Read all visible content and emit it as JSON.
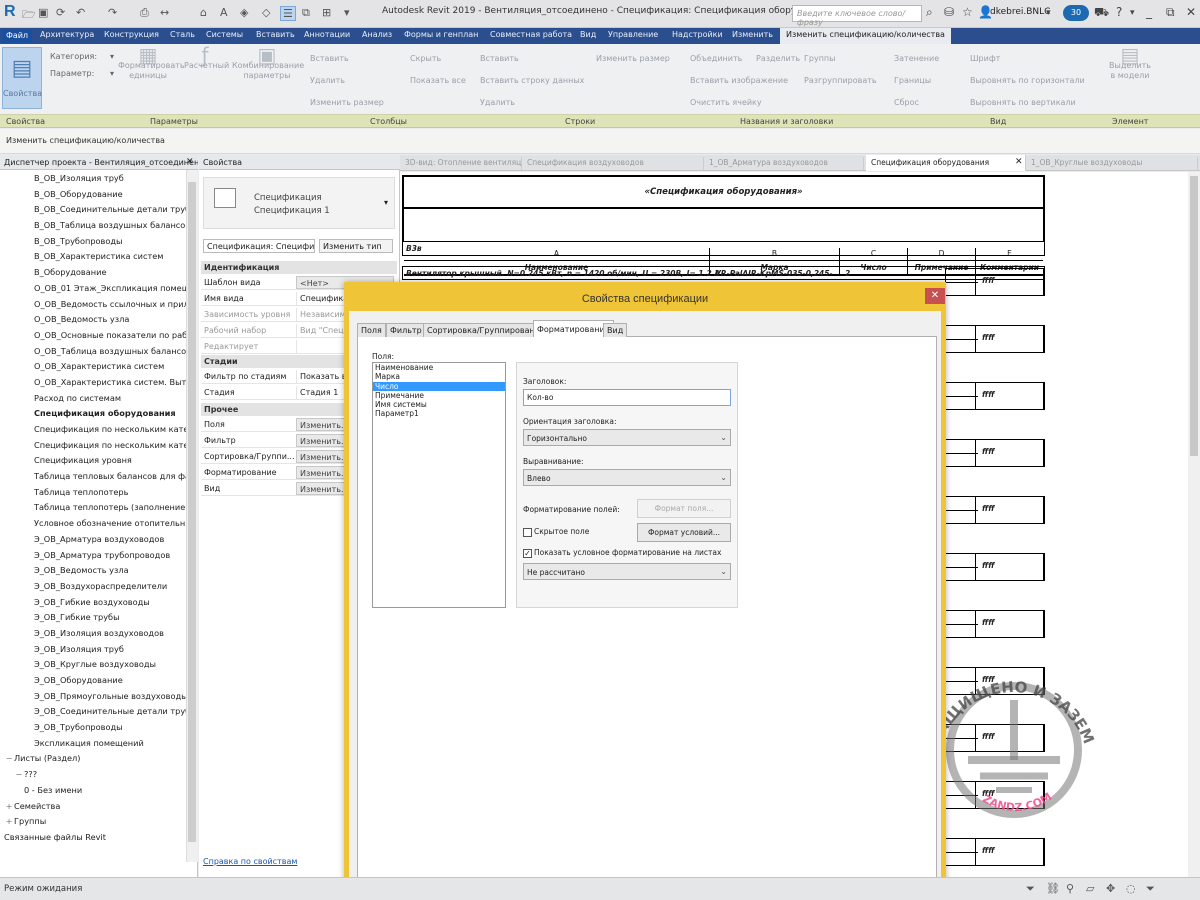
{
  "app": {
    "logo": "R",
    "window_title": "Autodesk Revit 2019 - Вентиляция_отсоединено - Спецификация: Спецификация оборудования",
    "search_placeholder": "Введите ключевое слово/фразу",
    "user": "dkebrei.BNLC",
    "notifications": "30"
  },
  "ribbon": {
    "file_tab": "Файл",
    "tabs": [
      "Архитектура",
      "Конструкция",
      "Сталь",
      "Системы",
      "Вставить",
      "Аннотации",
      "Анализ",
      "Формы и генплан",
      "Совместная работа",
      "Вид",
      "Управление",
      "Надстройки",
      "Изменить"
    ],
    "active_tab": "Изменить спецификацию/количества",
    "groups": [
      "Свойства",
      "Параметры",
      "Столбцы",
      "Строки",
      "Названия и заголовки",
      "Вид",
      "Элемент"
    ],
    "properties_button": "Свойства",
    "category_label": "Категория:",
    "parameter_label": "Параметр:",
    "param_buttons": [
      "Форматировать единицы",
      "Расчетный",
      "Комбинирование параметры"
    ],
    "column_buttons": [
      "Вставить",
      "Удалить",
      "Изменить размер",
      "Скрыть",
      "Показать все",
      "Вставить",
      "Вставить строку данных",
      "Удалить"
    ],
    "row_buttons": [
      "Изменить размер"
    ],
    "title_buttons": [
      "Объединить",
      "Разделить",
      "Вставить изображение",
      "Очистить ячейку",
      "Группы",
      "Разгруппировать"
    ],
    "view_buttons": [
      "Затенение",
      "Границы",
      "Сброс",
      "Шрифт",
      "Выровнять по горизонтали",
      "Выровнять по вертикали"
    ],
    "element_button": "Выделить в модели",
    "context_label": "Изменить спецификацию/количества"
  },
  "browser": {
    "title": "Диспетчер проекта - Вентиляция_отсоединено",
    "items": [
      {
        "label": "В_ОВ_Изоляция труб",
        "indent": 3
      },
      {
        "label": "В_ОВ_Оборудование",
        "indent": 3
      },
      {
        "label": "В_ОВ_Соединительные детали трубопр",
        "indent": 3
      },
      {
        "label": "В_ОВ_Таблица воздушных балансов",
        "indent": 3
      },
      {
        "label": "В_ОВ_Трубопроводы",
        "indent": 3
      },
      {
        "label": "В_ОВ_Характеристика систем",
        "indent": 3
      },
      {
        "label": "В_Оборудование",
        "indent": 3
      },
      {
        "label": "О_ОВ_01 Этаж_Экспликация помещен",
        "indent": 3
      },
      {
        "label": "О_ОВ_Ведомость ссылочных и прилаг",
        "indent": 3
      },
      {
        "label": "О_ОВ_Ведомость узла",
        "indent": 3
      },
      {
        "label": "О_ОВ_Основные показатели по рабоч",
        "indent": 3
      },
      {
        "label": "О_ОВ_Таблица воздушных балансов",
        "indent": 3
      },
      {
        "label": "О_ОВ_Характеристика систем",
        "indent": 3
      },
      {
        "label": "О_ОВ_Характеристика систем. Вытяжн",
        "indent": 3
      },
      {
        "label": "Расход по системам",
        "indent": 3
      },
      {
        "label": "Спецификация оборудования",
        "indent": 3,
        "selected": true
      },
      {
        "label": "Спецификация по нескольким категор",
        "indent": 3
      },
      {
        "label": "Спецификация по нескольким категор",
        "indent": 3
      },
      {
        "label": "Спецификация уровня",
        "indent": 3
      },
      {
        "label": "Таблица тепловых балансов для фанко",
        "indent": 3
      },
      {
        "label": "Таблица теплопотерь",
        "indent": 3
      },
      {
        "label": "Таблица теплопотерь (заполнение)",
        "indent": 3
      },
      {
        "label": "Условное обозначение отопительных с",
        "indent": 3
      },
      {
        "label": "Э_ОВ_Арматура воздуховодов",
        "indent": 3
      },
      {
        "label": "Э_ОВ_Арматура трубопроводов",
        "indent": 3
      },
      {
        "label": "Э_ОВ_Ведомость узла",
        "indent": 3
      },
      {
        "label": "Э_ОВ_Воздухораспределители",
        "indent": 3
      },
      {
        "label": "Э_ОВ_Гибкие воздуховоды",
        "indent": 3
      },
      {
        "label": "Э_ОВ_Гибкие трубы",
        "indent": 3
      },
      {
        "label": "Э_ОВ_Изоляция воздуховодов",
        "indent": 3
      },
      {
        "label": "Э_ОВ_Изоляция труб",
        "indent": 3
      },
      {
        "label": "Э_ОВ_Круглые воздуховоды",
        "indent": 3
      },
      {
        "label": "Э_ОВ_Оборудование",
        "indent": 3
      },
      {
        "label": "Э_ОВ_Прямоугольные воздуховоды",
        "indent": 3
      },
      {
        "label": "Э_ОВ_Соединительные детали трубопр",
        "indent": 3
      },
      {
        "label": "Э_ОВ_Трубопроводы",
        "indent": 3
      },
      {
        "label": "Экспликация помещений",
        "indent": 3
      },
      {
        "label": "Листы (Раздел)",
        "indent": 0,
        "toggle": "−"
      },
      {
        "label": "???",
        "indent": 1,
        "toggle": "−"
      },
      {
        "label": "0 - Без имени",
        "indent": 2
      },
      {
        "label": "Семейства",
        "indent": 0,
        "toggle": "+"
      },
      {
        "label": "Группы",
        "indent": 0,
        "toggle": "+"
      },
      {
        "label": "Связанные файлы Revit",
        "indent": 0
      }
    ]
  },
  "properties": {
    "title": "Свойства",
    "type_line1": "Спецификация",
    "type_line2": "Спецификация 1",
    "selector": "Спецификация: Специфи",
    "edit_type": "Изменить тип",
    "sections": {
      "identity": "Идентификация",
      "stages": "Стадии",
      "other": "Прочее"
    },
    "rows_identity": [
      {
        "k": "Шаблон вида",
        "v": "<Нет>",
        "grey": false,
        "btn": true
      },
      {
        "k": "Имя вида",
        "v": "Спецификация",
        "grey": false
      },
      {
        "k": "Зависимость уровня",
        "v": "Независимый",
        "grey": true
      },
      {
        "k": "Рабочий набор",
        "v": "Вид \"Специф",
        "grey": true
      },
      {
        "k": "Редактирует",
        "v": "",
        "grey": true
      }
    ],
    "rows_stages": [
      {
        "k": "Фильтр по стадиям",
        "v": "Показать все"
      },
      {
        "k": "Стадия",
        "v": "Стадия 1"
      }
    ],
    "rows_other": [
      {
        "k": "Поля",
        "v": "Изменить..."
      },
      {
        "k": "Фильтр",
        "v": "Изменить..."
      },
      {
        "k": "Сортировка/Группи...",
        "v": "Изменить..."
      },
      {
        "k": "Форматирование",
        "v": "Изменить..."
      },
      {
        "k": "Вид",
        "v": "Изменить..."
      }
    ],
    "help_link": "Справка по свойствам"
  },
  "view_tabs": [
    {
      "label": "3D-вид: Отопление вентиляция",
      "active": false
    },
    {
      "label": "Спецификация воздуховодов",
      "active": false
    },
    {
      "label": "1_ОВ_Арматура воздуховодов",
      "active": false
    },
    {
      "label": "Спецификация оборудования",
      "active": true
    },
    {
      "label": "1_ОВ_Круглые воздуховоды",
      "active": false
    }
  ],
  "schedule": {
    "title": "«Спецификация оборудования»",
    "columns": [
      {
        "letter": "A",
        "header": "Наименование"
      },
      {
        "letter": "B",
        "header": "Марка"
      },
      {
        "letter": "C",
        "header": "Число"
      },
      {
        "letter": "D",
        "header": "Примечание"
      },
      {
        "letter": "E",
        "header": "Комментарии"
      }
    ],
    "group": "В3в",
    "row": {
      "name": "Вентилятор крышный. N=0.245 кВт, n = 1420 об/мин, U = 230В, I= 1.2 А",
      "mark": "VR-PalAIR-KpMS-035-0,245-",
      "count": "2"
    },
    "comment_value": "ffff"
  },
  "dialog": {
    "title": "Свойства спецификации",
    "tabs": [
      "Поля",
      "Фильтр",
      "Сортировка/Группирование",
      "Форматирование",
      "Вид"
    ],
    "active_tab": "Форматирование",
    "fields_label": "Поля:",
    "fields": [
      "Наименование",
      "Марка",
      "Число",
      "Примечание",
      "Имя системы",
      "Параметр1"
    ],
    "selected_field": "Число",
    "header_label": "Заголовок:",
    "header_value": "Кол-во",
    "orientation_label": "Ориентация заголовка:",
    "orientation_value": "Горизонтально",
    "alignment_label": "Выравнивание:",
    "alignment_value": "Влево",
    "field_format_label": "Форматирование полей:",
    "field_format_button": "Формат поля...",
    "hidden_field_label": "Скрытое поле",
    "hidden_field_checked": false,
    "cond_format_button": "Формат условий...",
    "show_cond_label": "Показать условное форматирование на листах",
    "show_cond_checked": true,
    "calc_value": "Не рассчитано"
  },
  "status": {
    "text": "Режим ожидания"
  },
  "watermark": {
    "top_text": "ЗАЩИЩЕНО И ЗАЗЕМЛЕНО",
    "bottom_text": "ZANDZ.COM"
  },
  "colors": {
    "ribbon_tab_bg": "#2b4f8e",
    "dialog_border": "#f0c437",
    "selection": "#3399ff"
  }
}
